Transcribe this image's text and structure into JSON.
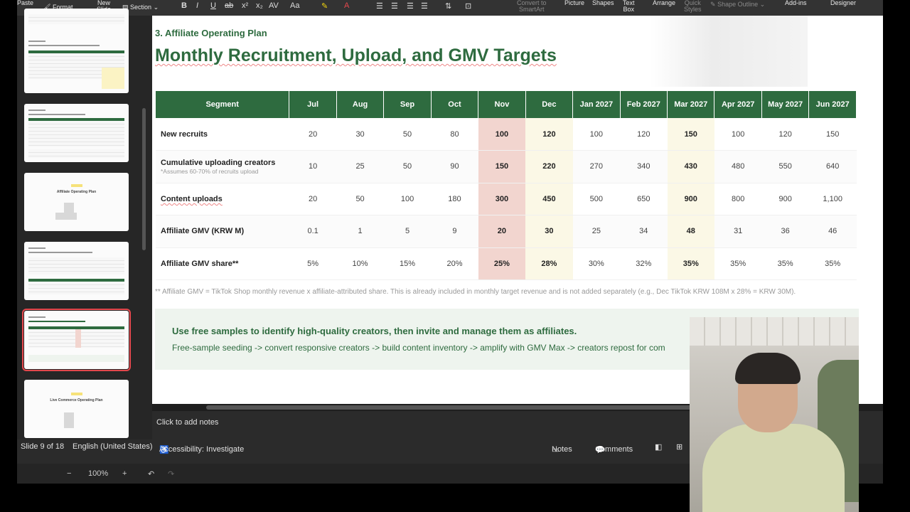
{
  "ribbon": {
    "paste": "Paste",
    "format": "Format",
    "new_slide_1": "New",
    "new_slide_2": "Slide",
    "section": "Section",
    "convert_1": "Convert to",
    "convert_2": "SmartArt",
    "picture": "Picture",
    "shapes": "Shapes",
    "textbox_1": "Text",
    "textbox_2": "Box",
    "arrange": "Arrange",
    "quick_1": "Quick",
    "quick_2": "Styles",
    "shape_outline": "Shape Outline",
    "addins": "Add-ins",
    "designer": "Designer"
  },
  "thumbnails": [
    {
      "title": "",
      "active": false
    },
    {
      "title": "",
      "active": false
    },
    {
      "title": "Affiliate Operating Plan",
      "active": false
    },
    {
      "title": "",
      "active": false
    },
    {
      "title": "",
      "active": true
    },
    {
      "title": "Live Commerce Operating Plan",
      "active": false
    }
  ],
  "slide": {
    "section_label": "3. Affiliate Operating Plan",
    "title": "Monthly Recruitment, Upload, and GMV Targets",
    "table": {
      "headers": [
        "Segment",
        "Jul",
        "Aug",
        "Sep",
        "Oct",
        "Nov",
        "Dec",
        "Jan 2027",
        "Feb 2027",
        "Mar 2027",
        "Apr 2027",
        "May 2027",
        "Jun 2027"
      ],
      "rows": [
        {
          "segment": "New recruits",
          "note": "",
          "values": [
            "20",
            "30",
            "50",
            "80",
            "100",
            "120",
            "100",
            "120",
            "150",
            "100",
            "120",
            "150"
          ]
        },
        {
          "segment": "Cumulative uploading creators",
          "note": "*Assumes 60-70% of recruits upload",
          "values": [
            "10",
            "25",
            "50",
            "90",
            "150",
            "220",
            "270",
            "340",
            "430",
            "480",
            "550",
            "640"
          ]
        },
        {
          "segment": "Content uploads",
          "note": "",
          "values": [
            "20",
            "50",
            "100",
            "180",
            "300",
            "450",
            "500",
            "650",
            "900",
            "800",
            "900",
            "1,100"
          ]
        },
        {
          "segment": "Affiliate GMV (KRW M)",
          "note": "",
          "values": [
            "0.1",
            "1",
            "5",
            "9",
            "20",
            "30",
            "25",
            "34",
            "48",
            "31",
            "36",
            "46"
          ]
        },
        {
          "segment": "Affiliate GMV share**",
          "note": "",
          "values": [
            "5%",
            "10%",
            "15%",
            "20%",
            "25%",
            "28%",
            "30%",
            "32%",
            "35%",
            "35%",
            "35%",
            "35%"
          ]
        }
      ]
    },
    "footnote": "** Affiliate GMV = TikTok Shop monthly revenue x affiliate-attributed share. This is already included in monthly target revenue and is not added separately (e.g., Dec TikTok KRW 108M x 28% = KRW 30M).",
    "callout_title": "Use free samples to identify high-quality creators, then invite and manage them as affiliates.",
    "callout_body": "Free-sample seeding -> convert responsive creators -> build content inventory -> amplify with GMV Max -> creators repost for com"
  },
  "notes_placeholder": "Click to add notes",
  "status": {
    "slide_count": "Slide 9 of 18",
    "language": "English (United States)",
    "accessibility": "Accessibility: Investigate",
    "notes": "Notes",
    "comments": "Comments"
  },
  "zoom": {
    "minus": "−",
    "level": "100%",
    "plus": "+"
  },
  "colors": {
    "brand_green": "#2e6b3f",
    "nov_highlight": "#f2d5cf",
    "dec_highlight": "#fbf8e6",
    "active_thumb": "#e5484d"
  }
}
